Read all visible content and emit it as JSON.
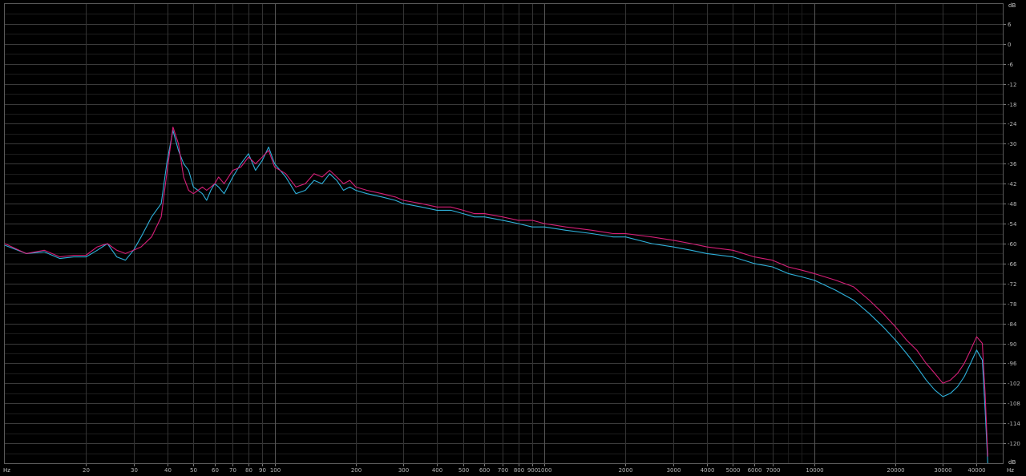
{
  "chart_data": {
    "type": "line",
    "title": "",
    "xlabel": "Hz",
    "ylabel": "dB",
    "x_scale": "log",
    "xlim": [
      10,
      50000
    ],
    "ylim": [
      -126,
      12
    ],
    "grid": true,
    "legend": "none",
    "x_unit_left": "Hz",
    "x_unit_right": "Hz",
    "y_unit_top": "dB",
    "y_unit_bottom": "dB",
    "x_ticks": [
      {
        "value": 20,
        "label": "20"
      },
      {
        "value": 30,
        "label": "30"
      },
      {
        "value": 40,
        "label": "40"
      },
      {
        "value": 50,
        "label": "50"
      },
      {
        "value": 60,
        "label": "60"
      },
      {
        "value": 70,
        "label": "70"
      },
      {
        "value": 80,
        "label": "80"
      },
      {
        "value": 90,
        "label": "90"
      },
      {
        "value": 100,
        "label": "100"
      },
      {
        "value": 200,
        "label": "200"
      },
      {
        "value": 300,
        "label": "300"
      },
      {
        "value": 400,
        "label": "400"
      },
      {
        "value": 500,
        "label": "500"
      },
      {
        "value": 600,
        "label": "600"
      },
      {
        "value": 700,
        "label": "700"
      },
      {
        "value": 800,
        "label": "800"
      },
      {
        "value": 900,
        "label": "900"
      },
      {
        "value": 1000,
        "label": "1000"
      },
      {
        "value": 2000,
        "label": "2000"
      },
      {
        "value": 3000,
        "label": "3000"
      },
      {
        "value": 4000,
        "label": "4000"
      },
      {
        "value": 5000,
        "label": "5000"
      },
      {
        "value": 6000,
        "label": "6000"
      },
      {
        "value": 7000,
        "label": "7000"
      },
      {
        "value": 10000,
        "label": "10000"
      },
      {
        "value": 20000,
        "label": "20000"
      },
      {
        "value": 30000,
        "label": "30000"
      },
      {
        "value": 40000,
        "label": "40000"
      }
    ],
    "y_ticks": [
      {
        "value": 6,
        "label": "6"
      },
      {
        "value": 0,
        "label": "0"
      },
      {
        "value": -6,
        "label": "-6"
      },
      {
        "value": -12,
        "label": "-12"
      },
      {
        "value": -18,
        "label": "-18"
      },
      {
        "value": -24,
        "label": "-24"
      },
      {
        "value": -30,
        "label": "-30"
      },
      {
        "value": -36,
        "label": "-36"
      },
      {
        "value": -42,
        "label": "-42"
      },
      {
        "value": -48,
        "label": "-48"
      },
      {
        "value": -54,
        "label": "-54"
      },
      {
        "value": -60,
        "label": "-60"
      },
      {
        "value": -66,
        "label": "-66"
      },
      {
        "value": -72,
        "label": "-72"
      },
      {
        "value": -78,
        "label": "-78"
      },
      {
        "value": -84,
        "label": "-84"
      },
      {
        "value": -90,
        "label": "-90"
      },
      {
        "value": -96,
        "label": "-96"
      },
      {
        "value": -102,
        "label": "-102"
      },
      {
        "value": -108,
        "label": "-108"
      },
      {
        "value": -114,
        "label": "-114"
      },
      {
        "value": -120,
        "label": "-120"
      }
    ],
    "series": [
      {
        "color": "#2fb9e6",
        "x": [
          10,
          12,
          14,
          16,
          18,
          20,
          22,
          24,
          26,
          28,
          30,
          32,
          35,
          38,
          40,
          42,
          44,
          46,
          48,
          50,
          52,
          54,
          56,
          58,
          60,
          62,
          65,
          70,
          75,
          80,
          85,
          90,
          95,
          100,
          110,
          120,
          130,
          140,
          150,
          160,
          170,
          180,
          190,
          200,
          220,
          250,
          280,
          300,
          350,
          400,
          450,
          500,
          550,
          600,
          700,
          800,
          900,
          1000,
          1200,
          1500,
          1800,
          2000,
          2500,
          3000,
          3500,
          4000,
          5000,
          6000,
          7000,
          8000,
          9000,
          10000,
          12000,
          14000,
          16000,
          18000,
          20000,
          22000,
          24000,
          26000,
          28000,
          30000,
          32000,
          34000,
          36000,
          38000,
          40000,
          42000,
          43000,
          44000
        ],
        "y": [
          -60.5,
          -63,
          -62.5,
          -64.5,
          -64,
          -64,
          -62,
          -60,
          -64,
          -65,
          -62,
          -58,
          -52,
          -48,
          -35,
          -26,
          -32,
          -36,
          -38,
          -43,
          -44,
          -45,
          -47,
          -44,
          -42,
          -43,
          -45,
          -40,
          -36,
          -33,
          -38,
          -35,
          -31,
          -36,
          -40,
          -45,
          -44,
          -41,
          -42,
          -39,
          -41,
          -44,
          -43,
          -44,
          -45,
          -46,
          -47,
          -48,
          -49,
          -50,
          -50,
          -51,
          -52,
          -52,
          -53,
          -54,
          -55,
          -55,
          -56,
          -57,
          -58,
          -58,
          -60,
          -61,
          -62,
          -63,
          -64,
          -66,
          -67,
          -69,
          -70,
          -71,
          -74,
          -77,
          -81,
          -85,
          -89,
          -93,
          -97,
          -101,
          -104,
          -106,
          -105,
          -103,
          -100,
          -96,
          -92,
          -95,
          -110,
          -126
        ]
      },
      {
        "color": "#e0207d",
        "x": [
          10,
          12,
          14,
          16,
          18,
          20,
          22,
          24,
          26,
          28,
          30,
          32,
          35,
          38,
          40,
          42,
          44,
          46,
          48,
          50,
          52,
          54,
          56,
          58,
          60,
          62,
          65,
          70,
          75,
          80,
          85,
          90,
          95,
          100,
          110,
          120,
          130,
          140,
          150,
          160,
          170,
          180,
          190,
          200,
          220,
          250,
          280,
          300,
          350,
          400,
          450,
          500,
          550,
          600,
          700,
          800,
          900,
          1000,
          1200,
          1500,
          1800,
          2000,
          2500,
          3000,
          3500,
          4000,
          5000,
          6000,
          7000,
          8000,
          9000,
          10000,
          12000,
          14000,
          16000,
          18000,
          20000,
          22000,
          24000,
          26000,
          28000,
          30000,
          32000,
          34000,
          36000,
          38000,
          40000,
          42000,
          43000,
          44000
        ],
        "y": [
          -60,
          -63,
          -62,
          -64,
          -63.5,
          -63.5,
          -61,
          -60,
          -62,
          -63,
          -62,
          -61,
          -58,
          -52,
          -38,
          -25,
          -30,
          -40,
          -44,
          -45,
          -44,
          -43,
          -44,
          -43,
          -42,
          -40,
          -42,
          -38,
          -37,
          -34,
          -36,
          -34,
          -32,
          -37,
          -39,
          -43,
          -42,
          -39,
          -40,
          -38,
          -40,
          -42,
          -41,
          -43,
          -44,
          -45,
          -46,
          -47,
          -48,
          -49,
          -49,
          -50,
          -51,
          -51,
          -52,
          -53,
          -53,
          -54,
          -55,
          -56,
          -57,
          -57,
          -58,
          -59,
          -60,
          -61,
          -62,
          -64,
          -65,
          -67,
          -68,
          -69,
          -71,
          -73,
          -77,
          -81,
          -85,
          -89,
          -92,
          -96,
          -99,
          -102,
          -101,
          -99,
          -96,
          -92,
          -88,
          -90,
          -105,
          -124
        ]
      }
    ]
  }
}
